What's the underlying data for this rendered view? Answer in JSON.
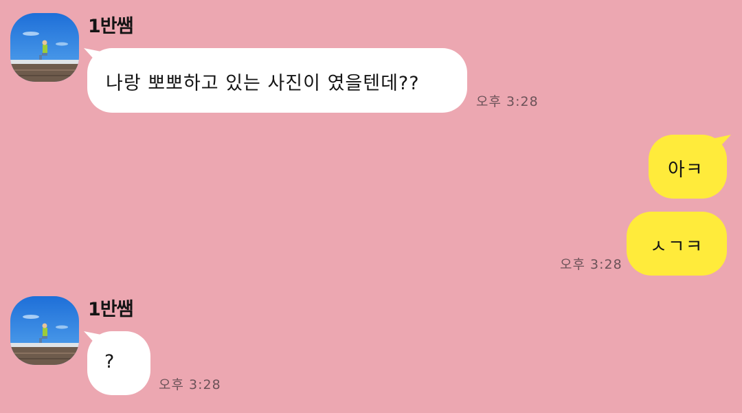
{
  "conversation": {
    "messages": [
      {
        "sender": "1반쌤",
        "text": "나랑 뽀뽀하고 있는 사진이 였을텐데??",
        "time": "오후 3:28"
      },
      {
        "sender": "me",
        "text": "아ㅋ"
      },
      {
        "sender": "me",
        "text": "ㅅㄱㅋ",
        "time": "오후 3:28"
      },
      {
        "sender": "1반쌤",
        "text": "?",
        "time": "오후 3:28"
      }
    ]
  },
  "colors": {
    "background": "#eca7b1",
    "incoming_bubble": "#ffffff",
    "outgoing_bubble": "#ffeb3b",
    "timestamp": "#6b5258"
  },
  "icons": {
    "avatar": "profile-photo-icon"
  }
}
